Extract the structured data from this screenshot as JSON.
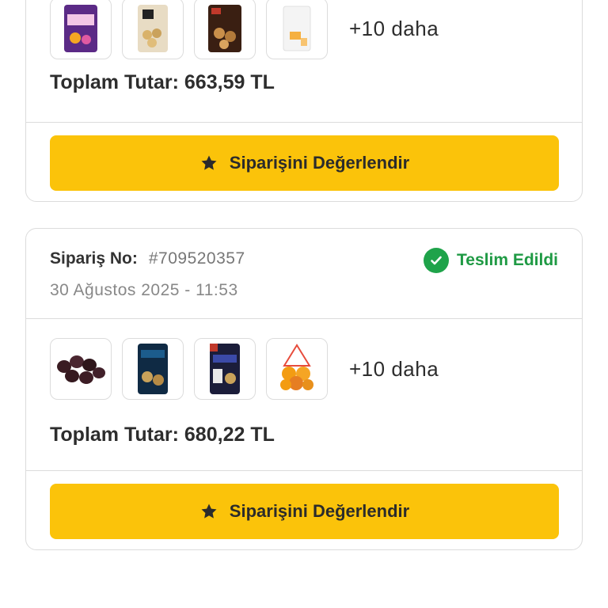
{
  "orders": [
    {
      "more_text": "+10 daha",
      "total_label": "Toplam Tutar:",
      "total_value": "663,59 TL",
      "rate_button": "Siparişini Değerlendir",
      "products": [
        {
          "icon": "puff-snack-bag"
        },
        {
          "icon": "popcorn-bag"
        },
        {
          "icon": "mixed-nuts-bag"
        },
        {
          "icon": "white-product-bag"
        }
      ]
    },
    {
      "order_label": "Sipariş No:",
      "order_no": "#709520357",
      "status": "Teslim Edildi",
      "date": "30 Ağustos 2025 - 11:53",
      "more_text": "+10 daha",
      "total_label": "Toplam Tutar:",
      "total_value": "680,22 TL",
      "rate_button": "Siparişini Değerlendir",
      "products": [
        {
          "icon": "dark-olives"
        },
        {
          "icon": "cerezza-snack-bag"
        },
        {
          "icon": "cerezza-snack-bag-2"
        },
        {
          "icon": "mandarin-net-bag"
        }
      ]
    }
  ],
  "colors": {
    "accent": "#fbc30a",
    "status_green": "#1fa34a"
  }
}
